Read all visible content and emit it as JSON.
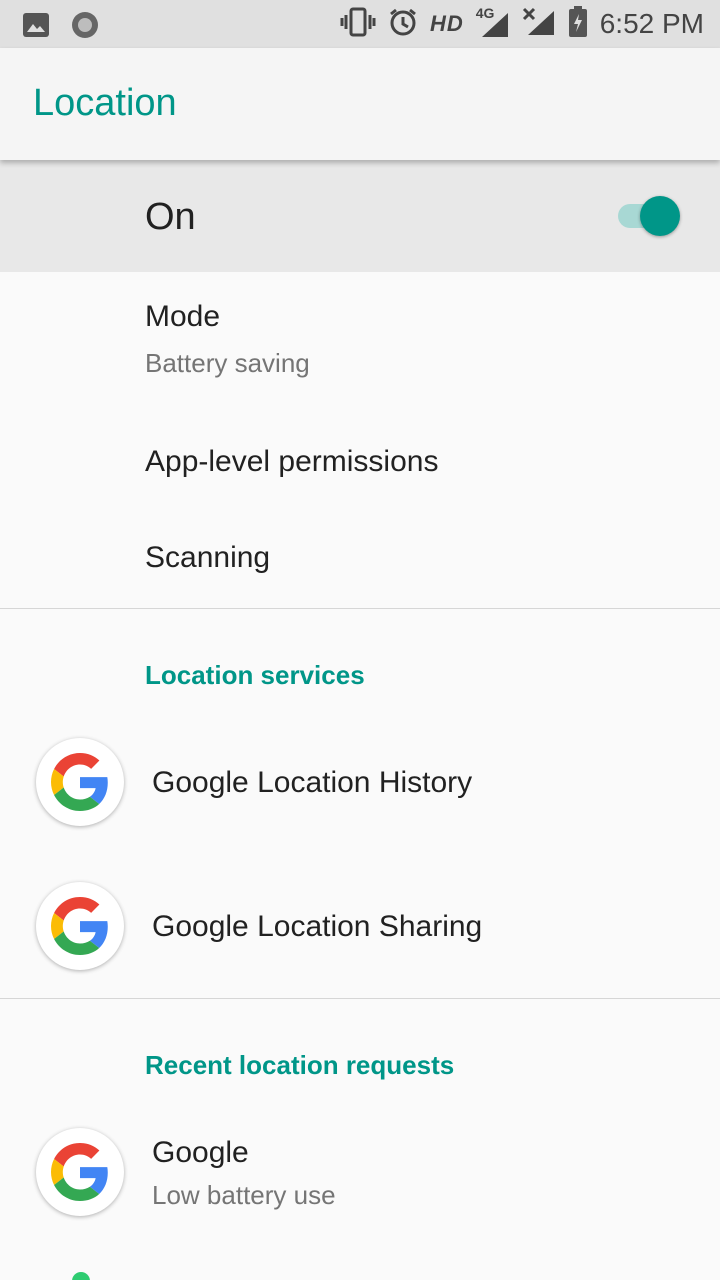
{
  "status_bar": {
    "time": "6:52 PM",
    "network_label": "HD",
    "network_type": "4G",
    "icons": [
      "image-icon",
      "circle-icon",
      "vibrate-icon",
      "alarm-icon",
      "signal-icon",
      "no-signal-icon",
      "battery-charging-icon"
    ]
  },
  "app_bar": {
    "title": "Location"
  },
  "master_switch": {
    "label": "On",
    "state": true,
    "accent": "#009688"
  },
  "settings": {
    "mode": {
      "title": "Mode",
      "subtitle": "Battery saving"
    },
    "app_permissions": {
      "title": "App-level permissions"
    },
    "scanning": {
      "title": "Scanning"
    }
  },
  "location_services": {
    "header": "Location services",
    "items": [
      {
        "title": "Google Location History",
        "icon": "google-icon"
      },
      {
        "title": "Google Location Sharing",
        "icon": "google-icon"
      }
    ]
  },
  "recent_requests": {
    "header": "Recent location requests",
    "items": [
      {
        "title": "Google",
        "subtitle": "Low battery use",
        "icon": "google-icon"
      }
    ]
  }
}
